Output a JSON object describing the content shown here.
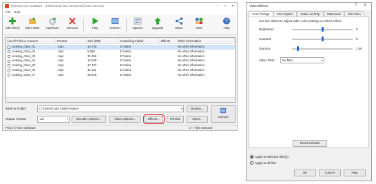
{
  "main": {
    "title": "Prism by NCH Software - (Unlicensed) Non-commercial home use only",
    "menu": [
      "File",
      "Help"
    ],
    "toolbar": [
      {
        "label": "Add File(s)",
        "icon": "add-file-icon"
      },
      {
        "label": "Add Folder",
        "icon": "add-folder-icon"
      },
      {
        "label": "Add DVD",
        "icon": "add-dvd-icon"
      },
      {
        "label": "Remove",
        "icon": "remove-icon"
      },
      {
        "label": "Play",
        "icon": "play-icon"
      },
      {
        "label": "Convert",
        "icon": "convert-icon"
      },
      {
        "label": "Options",
        "icon": "options-icon"
      },
      {
        "label": "Upgrade",
        "icon": "upgrade-icon"
      },
      {
        "label": "Share",
        "icon": "share-icon"
      },
      {
        "label": "Suite",
        "icon": "suite-icon"
      },
      {
        "label": "Help",
        "icon": "help-icon"
      }
    ],
    "columns": [
      "List of Files to Convert",
      "Format",
      "Size (MB)",
      "Containing Folder",
      "Effects",
      "Other Information"
    ],
    "rows": [
      {
        "name": "cooking_class_01",
        "format": ".mp4",
        "size": "14.726",
        "folder": "E:\\Video",
        "effects": "",
        "info": "No other information."
      },
      {
        "name": "cooking_class_02",
        "format": ".mp4",
        "size": "5.848",
        "folder": "E:\\Video",
        "effects": "",
        "info": "No other information."
      },
      {
        "name": "cooking_class_03",
        "format": ".mp4",
        "size": "31.266",
        "folder": "E:\\Video",
        "effects": "",
        "info": "No other information."
      },
      {
        "name": "cooking_class_04",
        "format": ".mp4",
        "size": "12.848",
        "folder": "E:\\Video",
        "effects": "",
        "info": "No other information."
      },
      {
        "name": "cooking_class_05",
        "format": ".mp4",
        "size": "17.437",
        "folder": "E:\\Video",
        "effects": "",
        "info": "No other information."
      },
      {
        "name": "cooking_class_06",
        "format": ".mp4",
        "size": "41.111",
        "folder": "E:\\Video",
        "effects": "",
        "info": "No other information."
      },
      {
        "name": "cooking_class_07",
        "format": ".mp4",
        "size": "20.926",
        "folder": "E:\\Video",
        "effects": "",
        "info": "No other information."
      }
    ],
    "save_to_label": "Save to Folder:",
    "save_to_value": "C:\\Users\\Cody Colker\\Videos",
    "browse_label": "Browse...",
    "output_format_label": "Output Format:",
    "output_format_value": ".avi",
    "encoder_options_label": "Encoder Options...",
    "video_options_label": "Video Options...",
    "effects_label": "Effects...",
    "preview_label": "Preview",
    "open_label": "Open...",
    "convert_label": "Convert",
    "status_left": "Prism © NCH Software",
    "status_right": "1 / 7 files selected"
  },
  "dialog": {
    "title": "Video Effects",
    "help_glyph": "?",
    "close_glyph": "✕",
    "tabs": [
      "Color Change",
      "Text Caption",
      "Rotate and Flip",
      "Watermark",
      "Edit Video"
    ],
    "instruction": "Use the sliders to adjust video color settings or select a filter.",
    "sliders": [
      {
        "label": "Brightness:",
        "value": "0",
        "position": 0.5
      },
      {
        "label": "Contrast:",
        "value": "0",
        "position": 0.5
      },
      {
        "label": "Gamma:",
        "value": "1.00",
        "position": 0.1
      }
    ],
    "filter_label": "Video Filter:",
    "filter_value": "No filter",
    "reset_label": "Reset Defaults",
    "apply_selected": "Apply to selected files(s)",
    "apply_all": "Apply to all files",
    "ok": "OK",
    "cancel": "Cancel",
    "help": "Help"
  },
  "colors": {
    "highlight": "#e02020",
    "accent": "#1e73d2",
    "selection": "#cfe4f7"
  }
}
